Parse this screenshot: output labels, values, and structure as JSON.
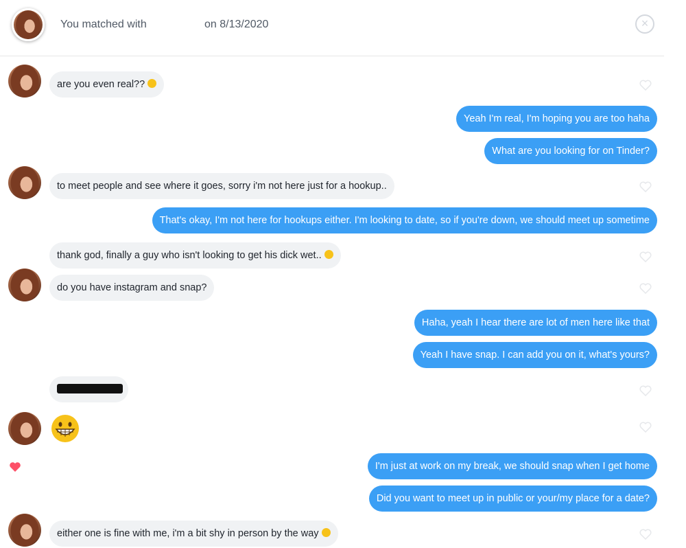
{
  "header": {
    "matched_label": "You matched with",
    "match_date": "on 8/13/2020",
    "close_icon": "×"
  },
  "messages": [
    {
      "side": "recv",
      "text": "are you even real??",
      "emoji": "smiling-face"
    },
    {
      "side": "sent",
      "text": "Yeah I'm real, I'm hoping you are too haha"
    },
    {
      "side": "sent",
      "text": "What are you looking for on Tinder?"
    },
    {
      "side": "recv",
      "text": "to meet people and see where it goes, sorry i'm not here just for a hookup.."
    },
    {
      "side": "sent",
      "text": "That's okay, I'm not here for hookups either. I'm looking to date, so if you're down, we should meet up sometime"
    },
    {
      "side": "recv",
      "text": "thank god, finally a guy who isn't looking to get his dick wet..",
      "emoji": "grinning-sweat"
    },
    {
      "side": "recv",
      "text": "do you have instagram and snap?"
    },
    {
      "side": "sent",
      "text": "Haha, yeah I hear there are lot of men here like that"
    },
    {
      "side": "sent",
      "text": "Yeah I have snap. I can add you on it, what's yours?"
    },
    {
      "side": "recv",
      "text": "",
      "redacted": true
    },
    {
      "side": "recv",
      "text": "",
      "emoji": "grinning-face-big"
    },
    {
      "side": "sent",
      "text": "I'm just at work on my break, we should snap when I get home",
      "liked": true
    },
    {
      "side": "sent",
      "text": "Did you want to meet up in public or your/my place for a date?"
    },
    {
      "side": "recv",
      "text": "either one is fine with me, i'm a bit shy in person by the way",
      "emoji": "grinning-sweat"
    }
  ],
  "colors": {
    "sent_bubble": "#3b9ff5",
    "recv_bubble": "#f0f2f4",
    "like_heart": "#fd5068"
  }
}
